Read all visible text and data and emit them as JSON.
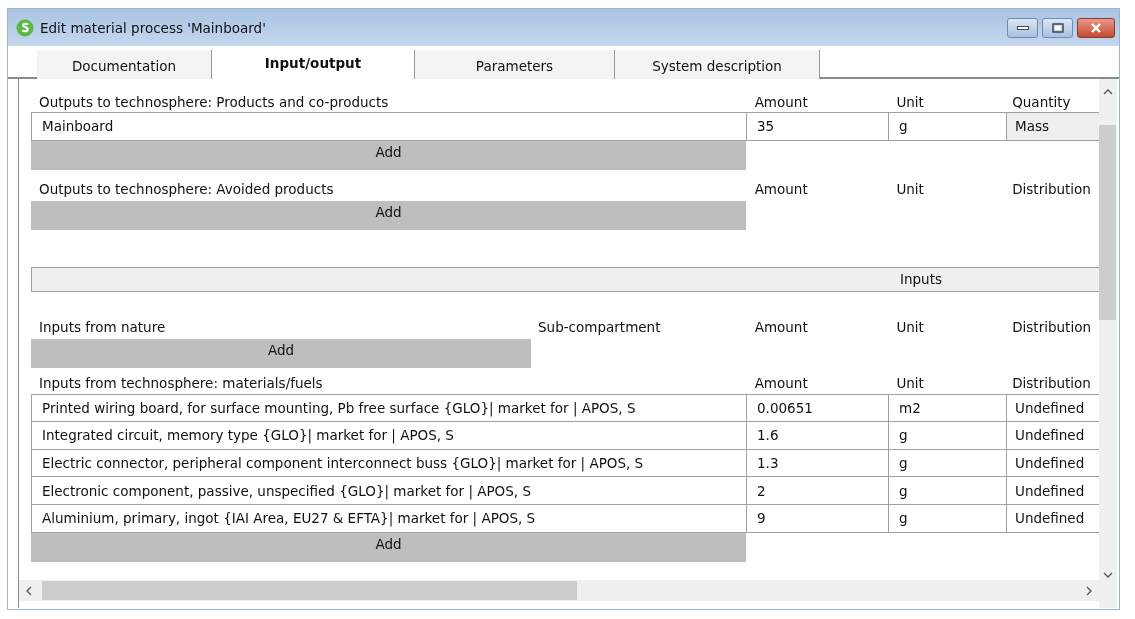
{
  "window": {
    "title": "Edit material process 'Mainboard'"
  },
  "tabs": [
    {
      "label": "Documentation",
      "selected": false
    },
    {
      "label": "Input/output",
      "selected": true
    },
    {
      "label": "Parameters",
      "selected": false
    },
    {
      "label": "System description",
      "selected": false
    }
  ],
  "sections": [
    {
      "kind": "table",
      "columns": [
        "Outputs to technosphere: Products and co-products",
        "Amount",
        "Unit",
        "Quantity"
      ],
      "rows": [
        {
          "cells": [
            "Mainboard",
            "35",
            "g",
            "Mass"
          ],
          "last_cell_read_only": true
        }
      ],
      "add_label": "Add"
    },
    {
      "kind": "table",
      "columns": [
        "Outputs to technosphere: Avoided products",
        "Amount",
        "Unit",
        "Distribution"
      ],
      "add_label": "Add"
    },
    {
      "kind": "banner",
      "label": "Inputs"
    },
    {
      "kind": "table",
      "columns": [
        "Inputs from nature",
        "Sub-compartment",
        "Amount",
        "Unit",
        "Distribution"
      ],
      "add_label": "Add"
    },
    {
      "kind": "table",
      "columns": [
        "Inputs from technosphere: materials/fuels",
        "Amount",
        "Unit",
        "Distribution"
      ],
      "rows": [
        {
          "cells": [
            "Printed wiring board, for surface mounting, Pb free surface {GLO}| market for | APOS, S",
            "0.00651",
            "m2",
            "Undefined"
          ],
          "last_cell_read_only": false
        },
        {
          "cells": [
            "Integrated circuit, memory type {GLO}| market for | APOS, S",
            "1.6",
            "g",
            "Undefined"
          ],
          "last_cell_read_only": false
        },
        {
          "cells": [
            "Electric connector, peripheral component interconnect buss {GLO}| market for | APOS, S",
            "1.3",
            "g",
            "Undefined"
          ],
          "last_cell_read_only": false
        },
        {
          "cells": [
            "Electronic component, passive, unspecified {GLO}| market for | APOS, S",
            "2",
            "g",
            "Undefined"
          ],
          "last_cell_read_only": false
        },
        {
          "cells": [
            "Aluminium, primary, ingot {IAI Area, EU27 & EFTA}| market for | APOS, S",
            "9",
            "g",
            "Undefined"
          ],
          "last_cell_read_only": false
        }
      ],
      "add_label": "Add"
    }
  ]
}
